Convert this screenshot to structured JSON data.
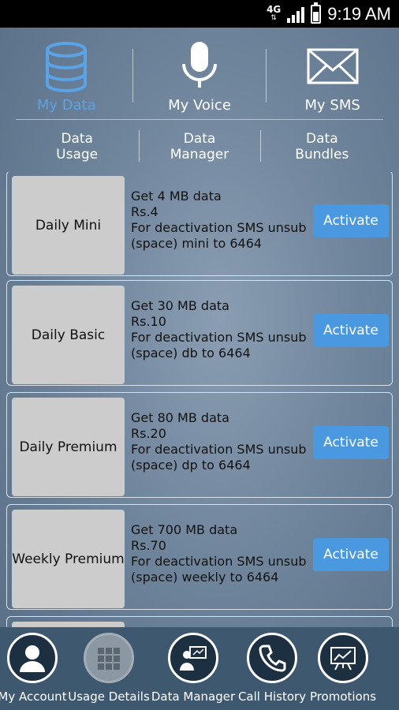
{
  "status": {
    "network": "4G",
    "time": "9:19 AM"
  },
  "topnav": [
    {
      "label": "My Data",
      "icon": "database-icon",
      "active": true
    },
    {
      "label": "My Voice",
      "icon": "microphone-icon",
      "active": false
    },
    {
      "label": "My SMS",
      "icon": "envelope-icon",
      "active": false
    }
  ],
  "subnav": [
    {
      "line1": "Data",
      "line2": "Usage"
    },
    {
      "line1": "Data",
      "line2": "Manager"
    },
    {
      "line1": "Data",
      "line2": "Bundles"
    }
  ],
  "bundles": [
    {
      "name": "Daily Mini",
      "line1": "Get 4 MB data",
      "line2": "Rs.4",
      "line3": "For deactivation SMS unsub",
      "line4": "(space) mini to 6464",
      "button": "Activate"
    },
    {
      "name": "Daily Basic",
      "line1": "Get 30 MB data",
      "line2": "Rs.10",
      "line3": "For deactivation SMS unsub",
      "line4": "(space) db to 6464",
      "button": "Activate"
    },
    {
      "name": "Daily Premium",
      "line1": "Get 80 MB data",
      "line2": "Rs.20",
      "line3": "For deactivation SMS unsub",
      "line4": "(space) dp to 6464",
      "button": "Activate"
    },
    {
      "name": "Weekly Premium",
      "line1": "Get 700 MB data",
      "line2": "Rs.70",
      "line3": "For deactivation SMS unsub",
      "line4": "(space) weekly to 6464",
      "button": "Activate"
    }
  ],
  "bottomnav": [
    {
      "label": "My Account",
      "icon": "user-icon"
    },
    {
      "label": "Usage Details",
      "icon": "grid-icon",
      "active": true
    },
    {
      "label": "Data Manager",
      "icon": "presenter-icon"
    },
    {
      "label": "Call History",
      "icon": "phone-icon"
    },
    {
      "label": "Promotions",
      "icon": "chart-board-icon"
    }
  ],
  "colors": {
    "accent": "#4a98e0",
    "active_label": "#5aa3e6",
    "bottombar": "#3e5870"
  }
}
